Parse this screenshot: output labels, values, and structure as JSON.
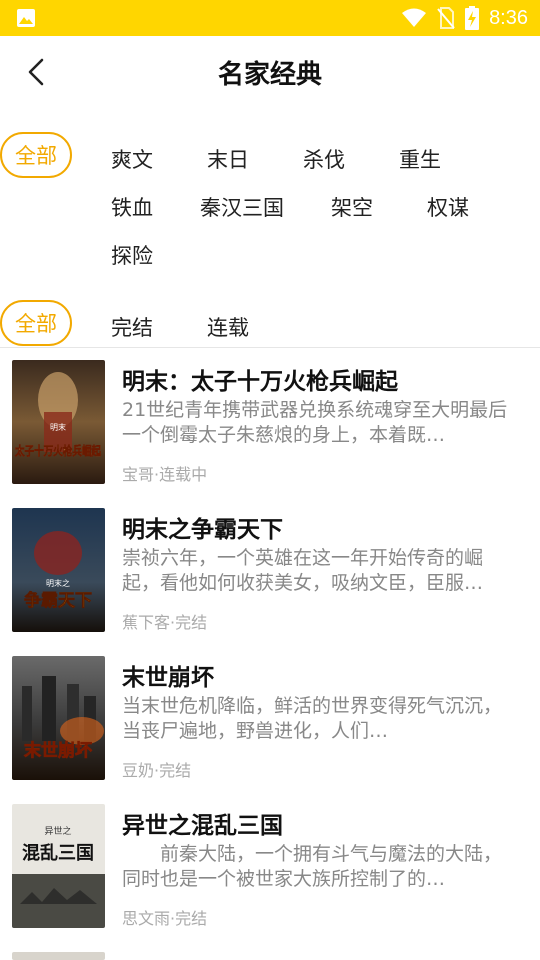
{
  "status_bar": {
    "time": "8:36"
  },
  "header": {
    "title": "名家经典"
  },
  "genre_filter": {
    "selected": "全部",
    "row1": [
      "爽文",
      "末日",
      "杀伐",
      "重生"
    ],
    "row2": [
      "铁血",
      "秦汉三国",
      "架空",
      "权谋"
    ],
    "row3": [
      "探险"
    ]
  },
  "status_filter": {
    "selected": "全部",
    "options": [
      "完结",
      "连载"
    ]
  },
  "books": [
    {
      "title": "明末：太子十万火枪兵崛起",
      "desc": "21世纪青年携带武器兑换系统魂穿至大明最后一个倒霉太子朱慈烺的身上，本着既…",
      "meta": "宝哥·连载中",
      "cover_text": "太子十万火枪兵崛起",
      "cover_badge": "明末"
    },
    {
      "title": "明末之争霸天下",
      "desc": "崇祯六年，一个英雄在这一年开始传奇的崛起，看他如何收获美女，吸纳文臣，臣服…",
      "meta": "蕉下客·完结",
      "cover_text": "争霸天下",
      "cover_badge": "明末之"
    },
    {
      "title": "末世崩坏",
      "desc": "当末世危机降临，鲜活的世界变得死气沉沉，　　　当丧尸遍地，野兽进化，人们…",
      "meta": "豆奶·完结",
      "cover_text": "末世崩坏",
      "cover_badge": ""
    },
    {
      "title": "异世之混乱三国",
      "desc": "　　前秦大陆，一个拥有斗气与魔法的大陆，同时也是一个被世家大族所控制了的…",
      "meta": "思文雨·完结",
      "cover_text": "混乱三国",
      "cover_badge": "异世之"
    }
  ],
  "colors": {
    "accent": "#f2a900",
    "status_bar": "#ffd600"
  }
}
